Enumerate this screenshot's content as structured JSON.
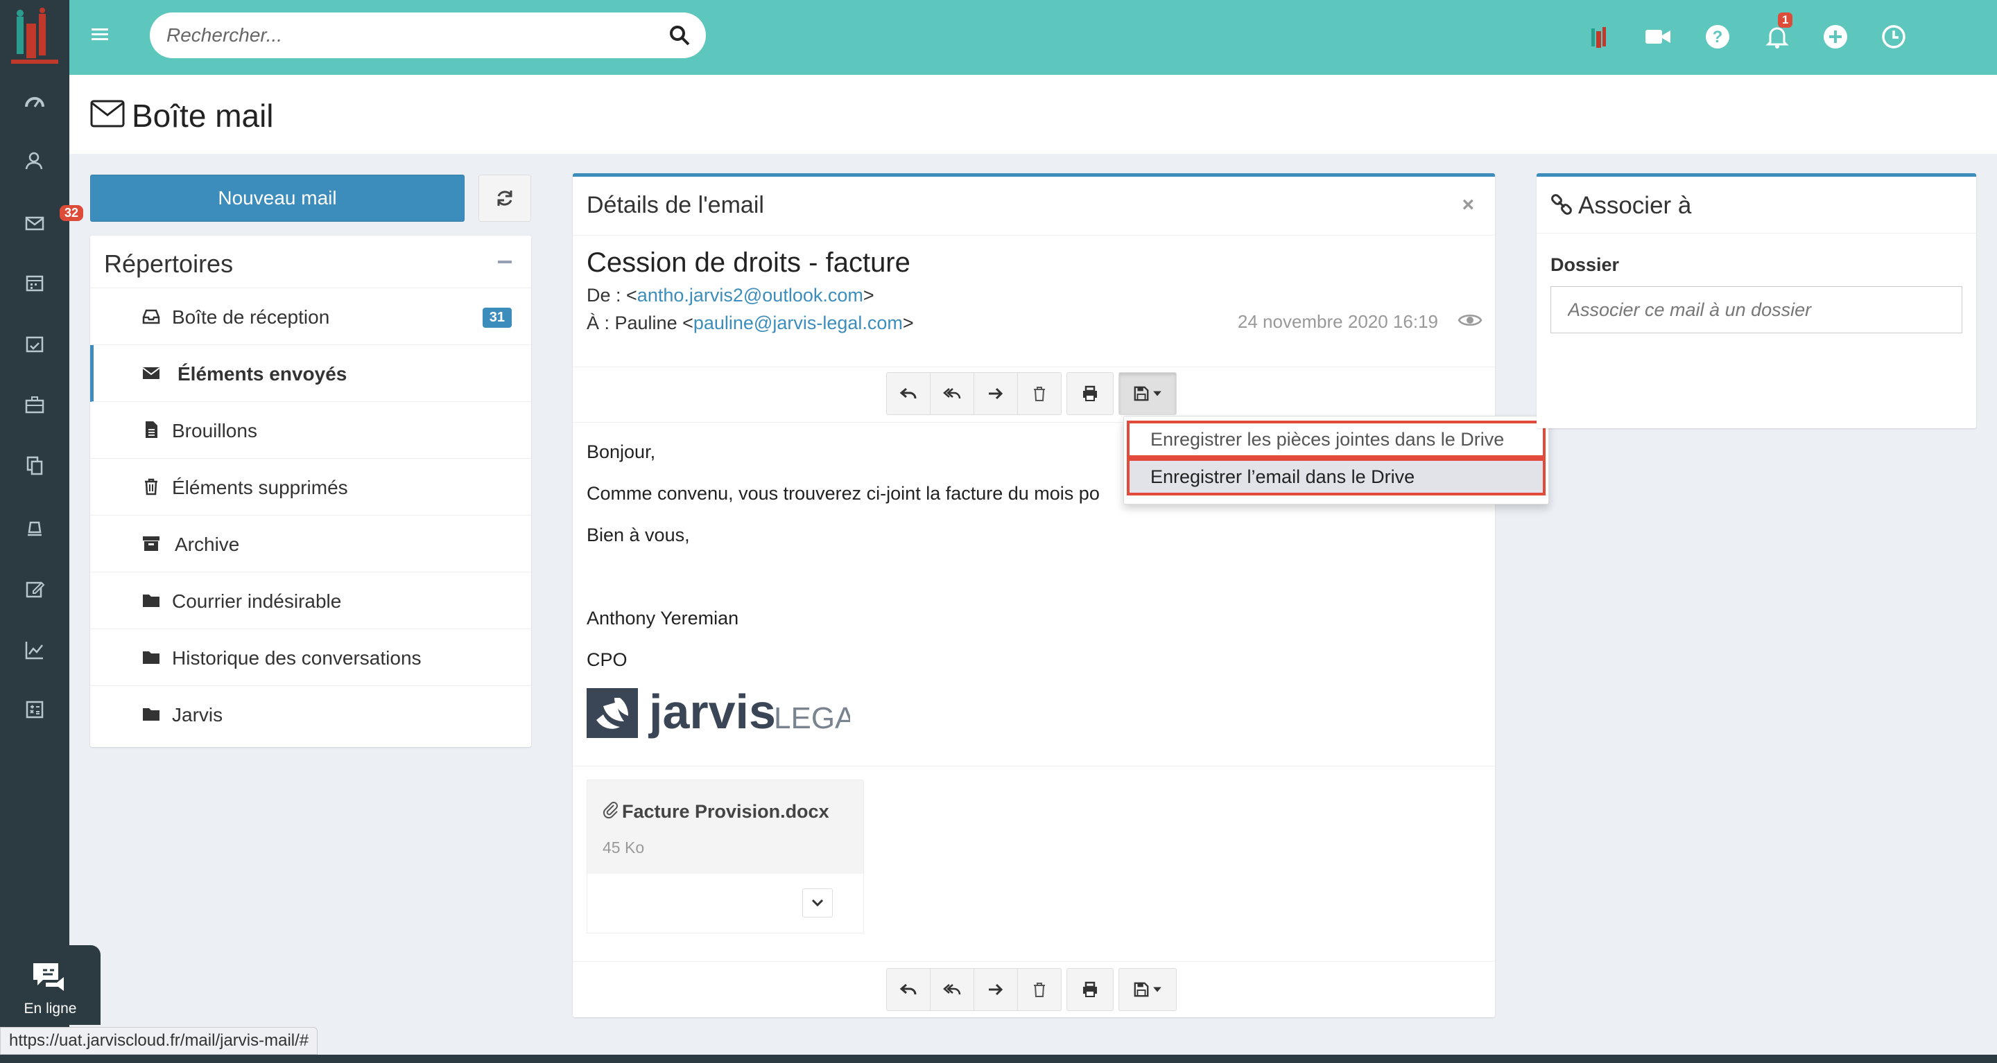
{
  "app": {
    "sidebar_badge_count": "32",
    "chat_label": "En ligne"
  },
  "header": {
    "search_placeholder": "Rechercher...",
    "notification_count": "1"
  },
  "page": {
    "title": "Boîte mail"
  },
  "left": {
    "new_mail_label": "Nouveau mail",
    "folders_title": "Répertoires",
    "folders": [
      {
        "label": "Boîte de réception",
        "icon": "inbox-icon",
        "badge": "31",
        "active": false
      },
      {
        "label": "Éléments envoyés",
        "icon": "envelope-icon",
        "active": true
      },
      {
        "label": "Brouillons",
        "icon": "file-icon",
        "active": false
      },
      {
        "label": "Éléments supprimés",
        "icon": "trash-icon",
        "active": false
      },
      {
        "label": "Archive",
        "icon": "archive-icon",
        "active": false
      },
      {
        "label": "Courrier indésirable",
        "icon": "folder-icon",
        "active": false
      },
      {
        "label": "Historique des conversations",
        "icon": "folder-icon",
        "active": false
      },
      {
        "label": "Jarvis",
        "icon": "folder-icon",
        "active": false
      }
    ]
  },
  "email": {
    "panel_title": "Détails de l'email",
    "close_label": "×",
    "subject": "Cession de droits - facture",
    "from_prefix": "De : <",
    "from_email": "antho.jarvis2@outlook.com",
    "from_suffix": ">",
    "to_prefix": "À : Pauline <",
    "to_email": "pauline@jarvis-legal.com",
    "to_suffix": ">",
    "date": "24 novembre 2020 16:19",
    "body": {
      "greeting": "Bonjour,",
      "line1": "Comme convenu, vous trouverez ci-joint la facture du mois po",
      "closing": "Bien à vous,",
      "signature_name": "Anthony Yeremian",
      "signature_title": "CPO"
    },
    "signature_logo": {
      "word1": "jarvis",
      "word2": "LEGAL"
    },
    "attachment": {
      "name": "Facture Provision.docx",
      "size": "45 Ko"
    },
    "save_menu": [
      "Enregistrer les pièces jointes dans le Drive",
      "Enregistrer l’email dans le Drive"
    ]
  },
  "associate": {
    "title": "Associer à",
    "field_label": "Dossier",
    "field_placeholder": "Associer ce mail à un dossier"
  },
  "statusbar": {
    "url": "https://uat.jarviscloud.fr/mail/jarvis-mail/#"
  },
  "colors": {
    "header": "#5ec7bd",
    "sidebar": "#2c3b41",
    "primary": "#3c8dbc",
    "highlight_border": "#e24a3b"
  }
}
